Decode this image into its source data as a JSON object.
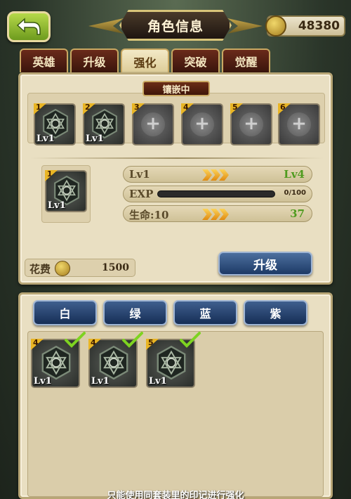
{
  "header": {
    "title": "角色信息",
    "gold": "48380"
  },
  "tabs": [
    {
      "label": "英雄",
      "active": false
    },
    {
      "label": "升级",
      "active": false
    },
    {
      "label": "强化",
      "active": true
    },
    {
      "label": "突破",
      "active": false
    },
    {
      "label": "觉醒",
      "active": false
    }
  ],
  "inlay": {
    "label": "镶嵌中",
    "slots": [
      {
        "num": "1",
        "filled": true,
        "lv": "Lv1"
      },
      {
        "num": "2",
        "filled": true,
        "lv": "Lv1"
      },
      {
        "num": "3",
        "filled": false,
        "lv": ""
      },
      {
        "num": "4",
        "filled": false,
        "lv": ""
      },
      {
        "num": "5",
        "filled": false,
        "lv": ""
      },
      {
        "num": "6",
        "filled": false,
        "lv": ""
      }
    ]
  },
  "selected": {
    "num": "1",
    "lv": "Lv1"
  },
  "stats": {
    "level_label": "Lv1",
    "level_next": "Lv4",
    "exp_label": "EXP",
    "exp_text": "0/100",
    "exp_progress": 0,
    "hp_label": "生命:10",
    "hp_next": "37"
  },
  "cost": {
    "label": "花费",
    "value": "1500"
  },
  "upgrade_label": "升级",
  "filters": [
    "白",
    "绿",
    "蓝",
    "紫"
  ],
  "inventory": [
    {
      "num": "4",
      "lv": "Lv1",
      "checked": true
    },
    {
      "num": "4",
      "lv": "Lv1",
      "checked": true
    },
    {
      "num": "5",
      "lv": "Lv1",
      "checked": true
    }
  ],
  "footer": "只能使用同套装里的印记进行强化",
  "colors": {
    "accent_green": "#4f9b1f",
    "button_blue": "#1d3a66",
    "tab_active": "#f3e9c6",
    "tab_inactive": "#3a150c"
  }
}
